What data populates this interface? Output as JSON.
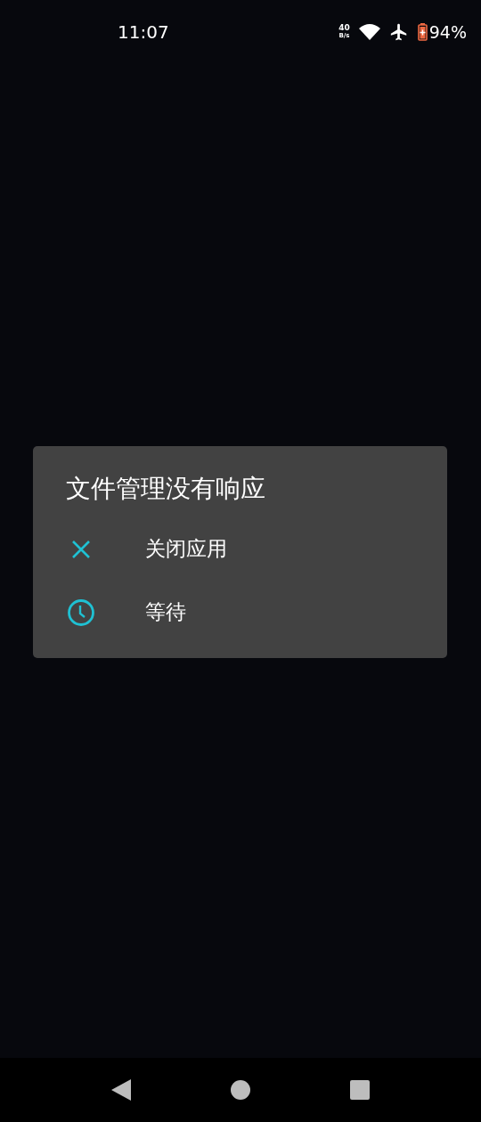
{
  "status_bar": {
    "time": "11:07",
    "net_speed": "40",
    "net_unit": "B/s",
    "battery": "94%"
  },
  "dialog": {
    "title": "文件管理没有响应",
    "actions": [
      {
        "kind": "close",
        "label": "关闭应用"
      },
      {
        "kind": "wait",
        "label": "等待"
      }
    ]
  }
}
